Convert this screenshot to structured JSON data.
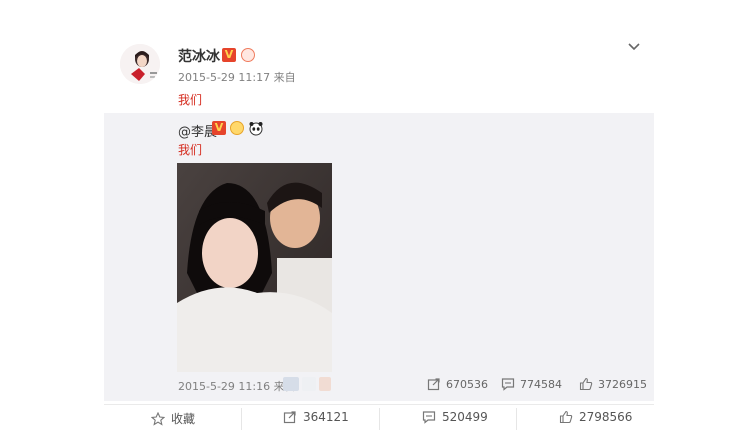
{
  "post": {
    "author": "范冰冰",
    "timestamp": "2015-5-29 11:17",
    "source_label": "来自",
    "text": "我们"
  },
  "repost": {
    "mention": "@李晨",
    "text": "我们",
    "timestamp": "2015-5-29 11:16",
    "source_label": "来自",
    "stats": {
      "reposts": "670536",
      "comments": "774584",
      "likes": "3726915"
    }
  },
  "actions": {
    "favorite_label": "收藏",
    "reposts": "364121",
    "comments": "520499",
    "likes": "2798566"
  },
  "icons": {
    "verified": "verified-v-badge-icon",
    "member": "member-badge-icon",
    "expand": "chevron-down-icon",
    "favorite": "star-icon",
    "repost": "repost-icon",
    "comment": "comment-icon",
    "like": "thumbs-up-icon",
    "panda": "panda-emoji-icon"
  },
  "colors": {
    "verified_badge": "#e6442b",
    "post_text": "#d52b1e",
    "repost_background": "#f2f2f5"
  }
}
